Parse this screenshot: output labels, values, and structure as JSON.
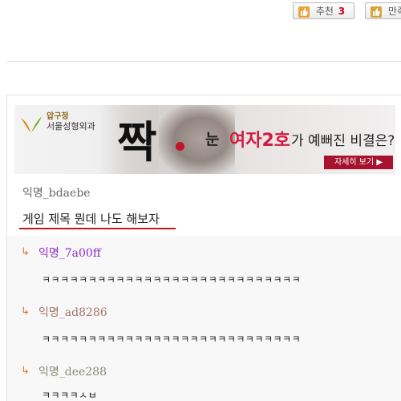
{
  "actions": {
    "recommend_label": "추천",
    "recommend_count": "3",
    "other_label": "만족"
  },
  "banner": {
    "hospital_top": "압구정",
    "hospital_name": "서울성형외과",
    "big_char": "짝",
    "eye": "눈",
    "highlight": "여자2호",
    "rest": "가 예뻐진 비결은?",
    "button": "자세히 보기 ▶"
  },
  "post": {
    "author": "익명_bdaebe",
    "title": "게임 제목 뭔데 나도 해보자"
  },
  "comments": [
    {
      "arrow": "↳",
      "author": "익명_7a00ff",
      "author_color": "#8a2cc6",
      "body": "ㅋㅋㅋㅋㅋㅋㅋㅋㅋㅋㅋㅋㅋㅋㅋㅋㅋㅋㅋㅋㅋㅋㅋㅋㅋㅋㅋㅋ"
    },
    {
      "arrow": "↳",
      "author": "익명_ad8286",
      "author_color": "#a3726d",
      "body": "ㅋㅋㅋㅋㅋㅋㅋㅋㅋㅋㅋㅋㅋㅋㅋㅋㅋㅋㅋㅋㅋㅋㅋㅋㅋㅋㅋㅋ"
    },
    {
      "arrow": "↳",
      "author": "익명_dee288",
      "author_color": "#8c8a73",
      "body": "ㅋㅋㅋㅋㅅㅂ"
    }
  ],
  "colors": {
    "accent_red": "#c2161c",
    "reply_arrow": "#e07a2a"
  }
}
